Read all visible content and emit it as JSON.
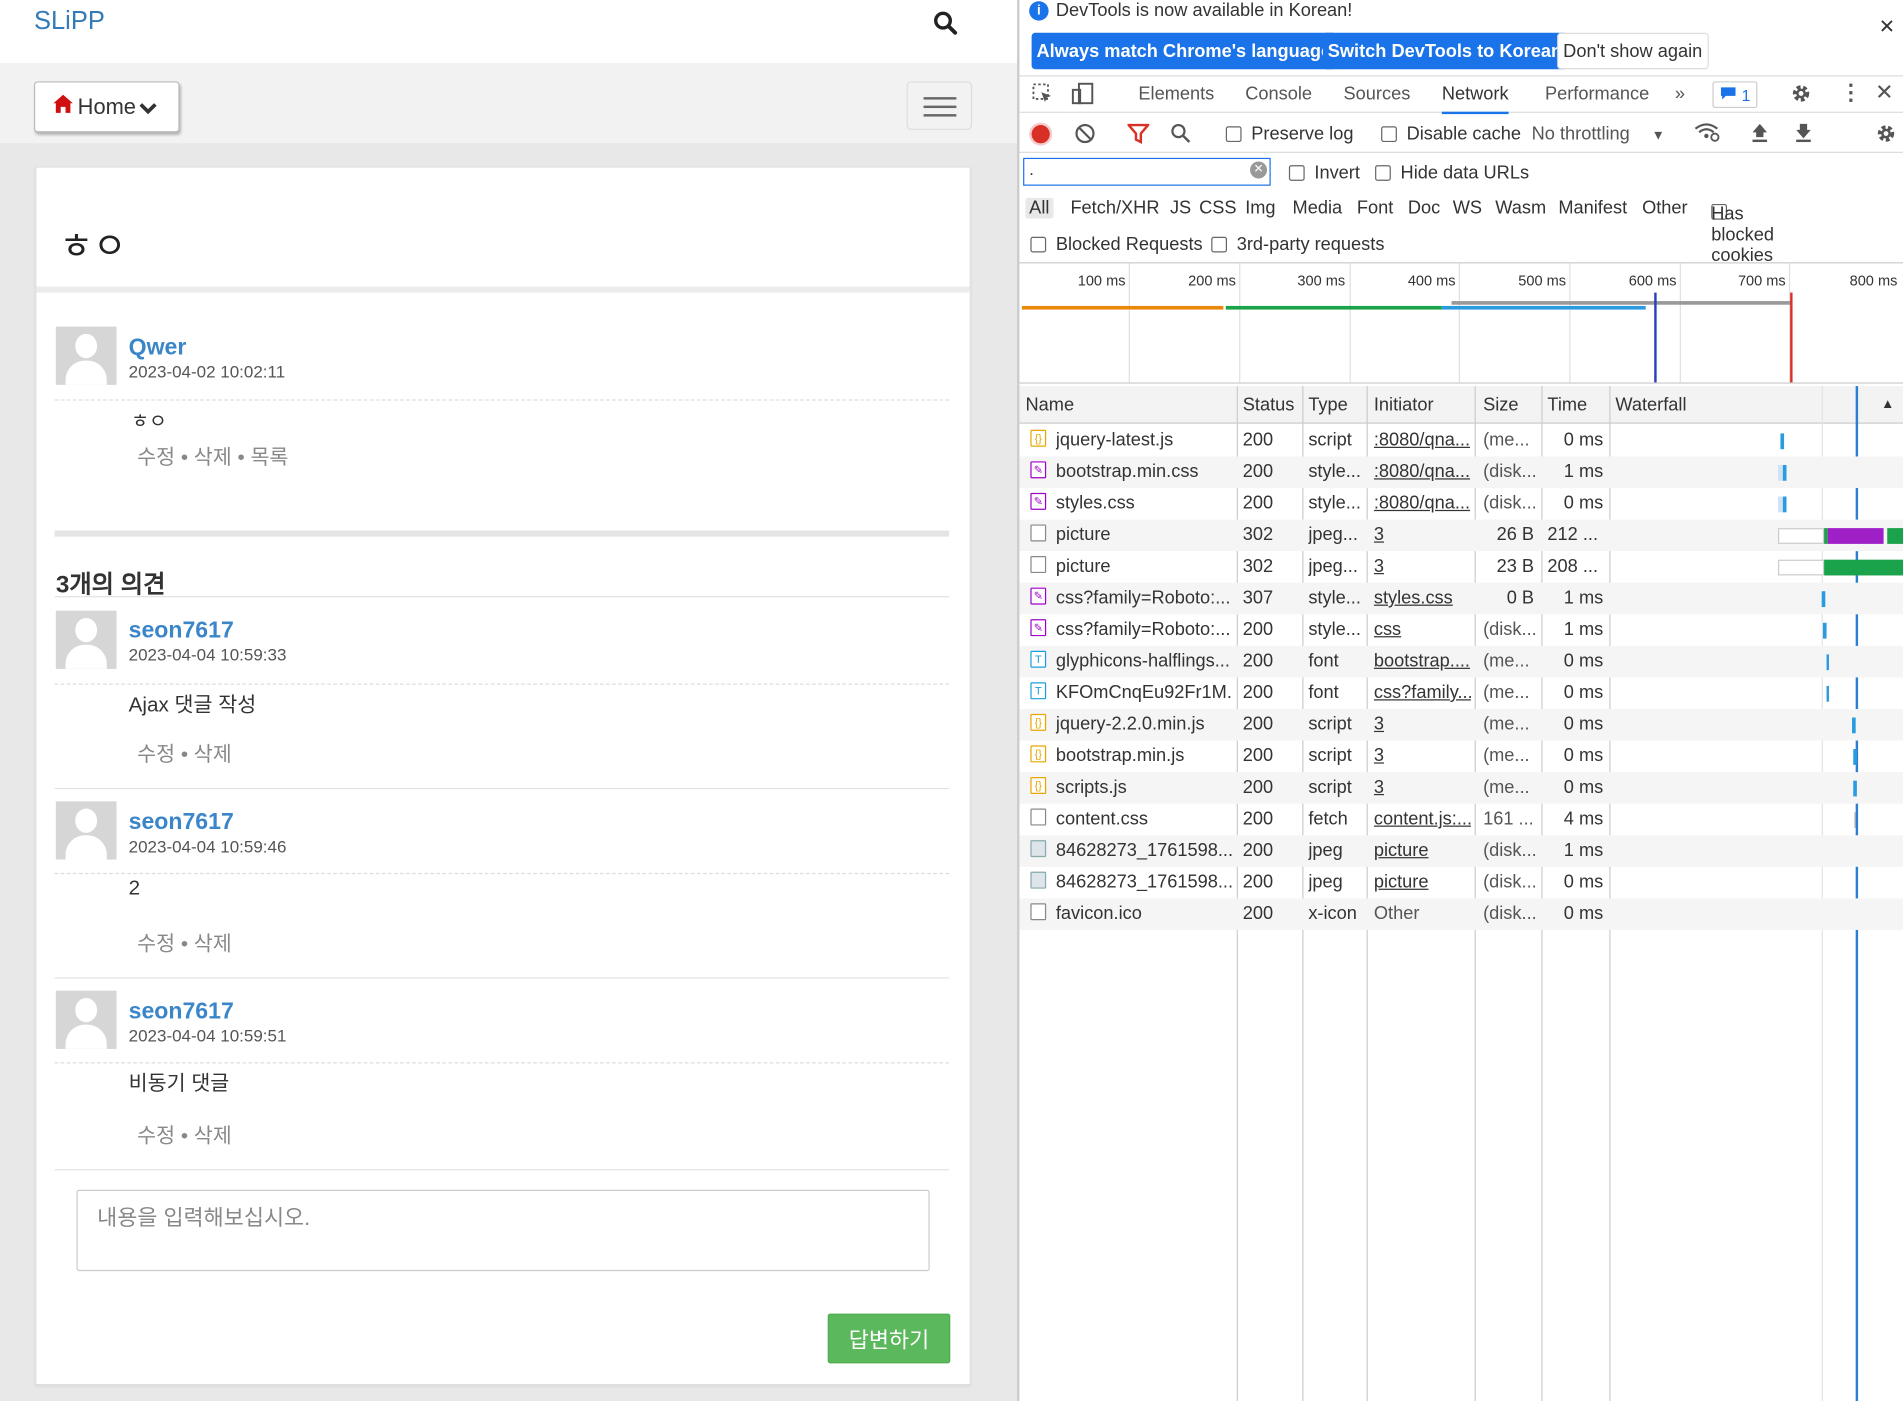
{
  "left": {
    "brand": "SLiPP",
    "nav": {
      "home_label": "Home"
    },
    "question": {
      "title": "ㅎㅇ",
      "author": "Qwer",
      "date": "2023-04-02 10:02:11",
      "body": "ㅎㅇ",
      "actions": "수정 • 삭제 • 목록"
    },
    "comment_count": "3개의 의견",
    "comments": [
      {
        "author": "seon7617",
        "date": "2023-04-04 10:59:33",
        "body": "Ajax 댓글 작성",
        "actions": "수정 • 삭제"
      },
      {
        "author": "seon7617",
        "date": "2023-04-04 10:59:46",
        "body": "2",
        "actions": "수정 • 삭제"
      },
      {
        "author": "seon7617",
        "date": "2023-04-04 10:59:51",
        "body": "비동기 댓글",
        "actions": "수정 • 삭제"
      }
    ],
    "reply": {
      "placeholder": "내용을 입력해보십시오.",
      "submit": "답변하기"
    }
  },
  "devtools": {
    "info_text": "DevTools is now available in Korean!",
    "lang_buttons": {
      "always": "Always match Chrome's language",
      "switch": "Switch DevTools to Korean",
      "dont": "Don't show again"
    },
    "tabs": [
      "Elements",
      "Console",
      "Sources",
      "Network",
      "Performance"
    ],
    "active_tab": "Network",
    "issue_count": "1",
    "toolbar": {
      "preserve_log": "Preserve log",
      "disable_cache": "Disable cache",
      "throttling": "No throttling"
    },
    "filter": {
      "value": ".",
      "invert": "Invert",
      "hide_data_urls": "Hide data URLs"
    },
    "types": [
      "All",
      "Fetch/XHR",
      "JS",
      "CSS",
      "Img",
      "Media",
      "Font",
      "Doc",
      "WS",
      "Wasm",
      "Manifest",
      "Other"
    ],
    "has_blocked_cookies": "Has blocked cookies",
    "blocked_requests": "Blocked Requests",
    "third_party": "3rd-party requests",
    "overview_ticks": [
      "100 ms",
      "200 ms",
      "300 ms",
      "400 ms",
      "500 ms",
      "600 ms",
      "700 ms",
      "800 ms"
    ],
    "columns": [
      "Name",
      "Status",
      "Type",
      "Initiator",
      "Size",
      "Time",
      "Waterfall"
    ],
    "requests": [
      {
        "name": "jquery-latest.js",
        "status": "200",
        "type": "script",
        "initiator": ":8080/qna...",
        "size": "(me...",
        "time": "0 ms",
        "icon": "script"
      },
      {
        "name": "bootstrap.min.css",
        "status": "200",
        "type": "style...",
        "initiator": ":8080/qna...",
        "size": "(disk...",
        "time": "1 ms",
        "icon": "style"
      },
      {
        "name": "styles.css",
        "status": "200",
        "type": "style...",
        "initiator": ":8080/qna...",
        "size": "(disk...",
        "time": "0 ms",
        "icon": "style"
      },
      {
        "name": "picture",
        "status": "302",
        "type": "jpeg...",
        "initiator": "3",
        "size": "26 B",
        "time": "212 ...",
        "icon": "doc"
      },
      {
        "name": "picture",
        "status": "302",
        "type": "jpeg...",
        "initiator": "3",
        "size": "23 B",
        "time": "208 ...",
        "icon": "doc"
      },
      {
        "name": "css?family=Roboto:...",
        "status": "307",
        "type": "style...",
        "initiator": "styles.css",
        "size": "0 B",
        "time": "1 ms",
        "icon": "style"
      },
      {
        "name": "css?family=Roboto:...",
        "status": "200",
        "type": "style...",
        "initiator": "css",
        "size": "(disk...",
        "time": "1 ms",
        "icon": "style"
      },
      {
        "name": "glyphicons-halflings...",
        "status": "200",
        "type": "font",
        "initiator": "bootstrap....",
        "size": "(me...",
        "time": "0 ms",
        "icon": "font"
      },
      {
        "name": "KFOmCnqEu92Fr1M...",
        "status": "200",
        "type": "font",
        "initiator": "css?family...",
        "size": "(me...",
        "time": "0 ms",
        "icon": "font"
      },
      {
        "name": "jquery-2.2.0.min.js",
        "status": "200",
        "type": "script",
        "initiator": "3",
        "size": "(me...",
        "time": "0 ms",
        "icon": "script"
      },
      {
        "name": "bootstrap.min.js",
        "status": "200",
        "type": "script",
        "initiator": "3",
        "size": "(me...",
        "time": "0 ms",
        "icon": "script"
      },
      {
        "name": "scripts.js",
        "status": "200",
        "type": "script",
        "initiator": "3",
        "size": "(me...",
        "time": "0 ms",
        "icon": "script"
      },
      {
        "name": "content.css",
        "status": "200",
        "type": "fetch",
        "initiator": "content.js:...",
        "size": "161 ...",
        "time": "4 ms",
        "icon": "blank"
      },
      {
        "name": "84628273_1761598...",
        "status": "200",
        "type": "jpeg",
        "initiator": "picture",
        "size": "(disk...",
        "time": "1 ms",
        "icon": "img"
      },
      {
        "name": "84628273_1761598...",
        "status": "200",
        "type": "jpeg",
        "initiator": "picture",
        "size": "(disk...",
        "time": "0 ms",
        "icon": "img"
      },
      {
        "name": "favicon.ico",
        "status": "200",
        "type": "x-icon",
        "initiator": "Other",
        "size": "(disk...",
        "time": "0 ms",
        "icon": "blank"
      }
    ],
    "colors": {
      "accent": "#1a73e8",
      "record": "#d93025",
      "submit": "#5cb85c",
      "link": "#337ab7"
    }
  }
}
